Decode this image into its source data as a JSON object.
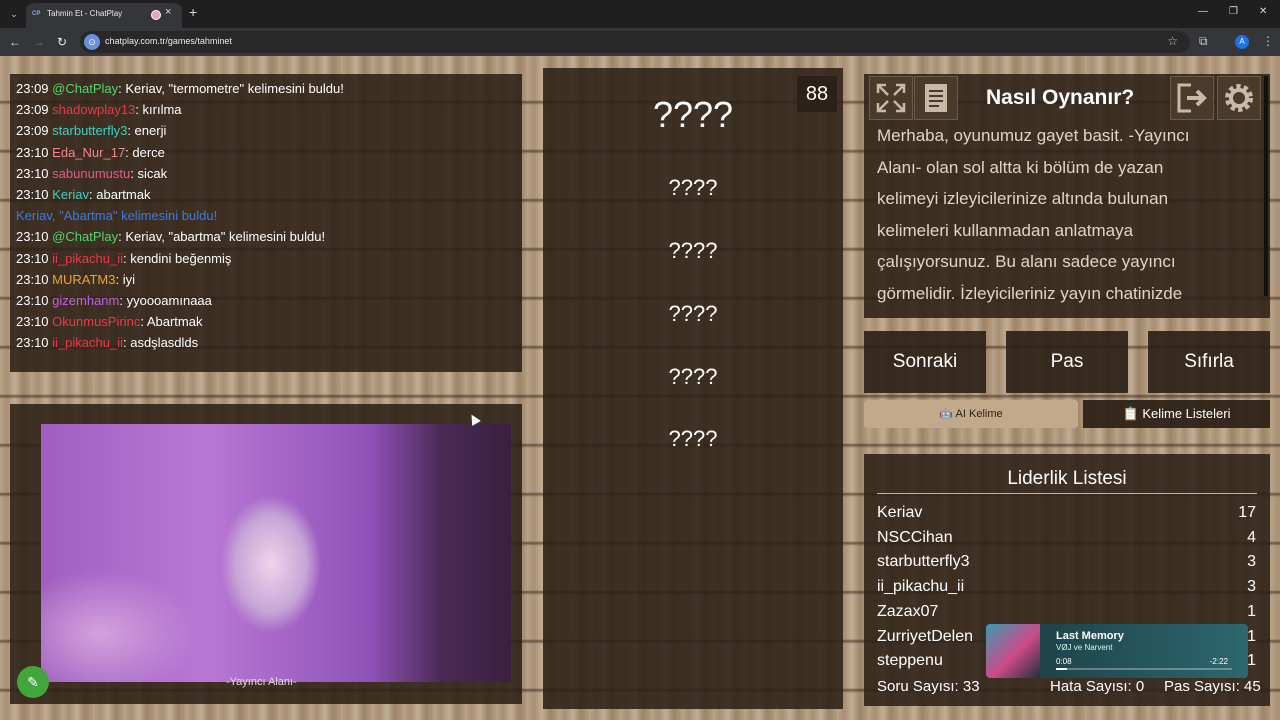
{
  "browser": {
    "tab_title": "Tahmin Et - ChatPlay",
    "tab_favicon": "CP",
    "url": "chatplay.com.tr/games/tahminet",
    "profile_initial": "A"
  },
  "chat": {
    "messages": [
      {
        "time": "23:09",
        "user": "@ChatPlay",
        "user_color": "#56d36a",
        "text": ": Keriav, \"termometre\" kelimesini buldu!"
      },
      {
        "time": "23:09",
        "user": "shadowplay13",
        "user_color": "#e8394b",
        "text": ": kırılma"
      },
      {
        "time": "23:09",
        "user": "starbutterfly3",
        "user_color": "#3ad0c0",
        "text": ": enerji"
      },
      {
        "time": "23:10",
        "user": "Eda_Nur_17",
        "user_color": "#f08a8a",
        "text": ": derce"
      },
      {
        "time": "23:10",
        "user": "sabunumustu",
        "user_color": "#e45a8a",
        "text": ": sicak"
      },
      {
        "time": "23:10",
        "user": "Keriav",
        "user_color": "#3ad0c0",
        "text": ": abartmak"
      },
      {
        "time": "",
        "user": "",
        "user_color": "#3a7be0",
        "text": "Keriav, \"Abartma\" kelimesini buldu!",
        "system": true
      },
      {
        "time": "23:10",
        "user": "@ChatPlay",
        "user_color": "#56d36a",
        "text": ": Keriav, \"abartma\" kelimesini buldu!"
      },
      {
        "time": "23:10",
        "user": "ii_pikachu_ii",
        "user_color": "#e8394b",
        "text": ": kendini beğenmiş"
      },
      {
        "time": "23:10",
        "user": "MURATM3",
        "user_color": "#f0a030",
        "text": ": iyi"
      },
      {
        "time": "23:10",
        "user": "gizemhanm",
        "user_color": "#c060e0",
        "text": ": yyoooamınaaa"
      },
      {
        "time": "23:10",
        "user": "OkunmusPirinc",
        "user_color": "#e8394b",
        "text": ": Abartmak"
      },
      {
        "time": "23:10",
        "user": "ii_pikachu_ii",
        "user_color": "#e8394b",
        "text": ": asdşlasdlds"
      }
    ]
  },
  "camera": {
    "label": "-Yayıncı Alanı-"
  },
  "words_panel": {
    "timer": "88",
    "main_word": "????",
    "forbidden_words": [
      "????",
      "????",
      "????",
      "????",
      "????"
    ]
  },
  "howto": {
    "title": "Nasıl Oynanır?",
    "text": "Merhaba, oyunumuz gayet basit. -Yayıncı Alanı- olan sol altta ki bölüm de yazan kelimeyi izleyicilerinize altında bulunan kelimeleri kullanmadan anlatmaya çalışıyorsunuz. Bu alanı sadece yayıncı görmelidir. İzleyicileriniz yayın chatinizde"
  },
  "controls": {
    "next": "Sonraki",
    "pass": "Pas",
    "reset": "Sıfırla",
    "ai_word": "🤖 AI Kelime",
    "word_lists": "📋 Kelime Listeleri"
  },
  "leaderboard": {
    "title": "Liderlik Listesi",
    "entries": [
      {
        "name": "Keriav",
        "score": "17"
      },
      {
        "name": "NSCCihan",
        "score": "4"
      },
      {
        "name": "starbutterfly3",
        "score": "3"
      },
      {
        "name": "ii_pikachu_ii",
        "score": "3"
      },
      {
        "name": "Zazax07",
        "score": "1"
      },
      {
        "name": "ZurriyetDelen",
        "score": "1"
      },
      {
        "name": "steppenu",
        "score": "1"
      }
    ]
  },
  "stats": {
    "questions": "Soru Sayısı: 33",
    "errors": "Hata Sayısı: 0",
    "passes": "Pas Sayısı: 45"
  },
  "media": {
    "title": "Last Memory",
    "artist": "VØJ ve Narvent",
    "elapsed": "0:08",
    "remaining": "-2:22",
    "progress": 0.06
  }
}
